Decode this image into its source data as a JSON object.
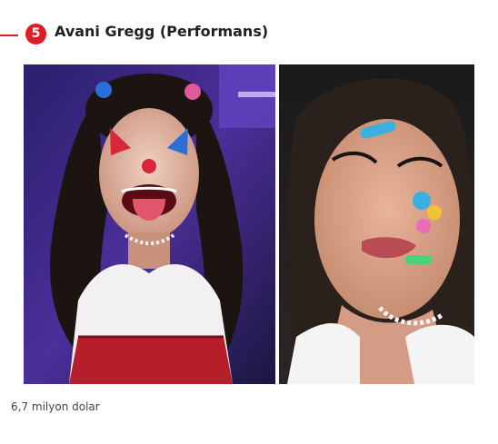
{
  "item": {
    "number": "5",
    "title": "Avani Gregg (Performans)",
    "caption": "6,7 milyon dolar"
  },
  "colors": {
    "accent": "#e31b23",
    "title_text": "#222222",
    "caption_text": "#444444"
  }
}
